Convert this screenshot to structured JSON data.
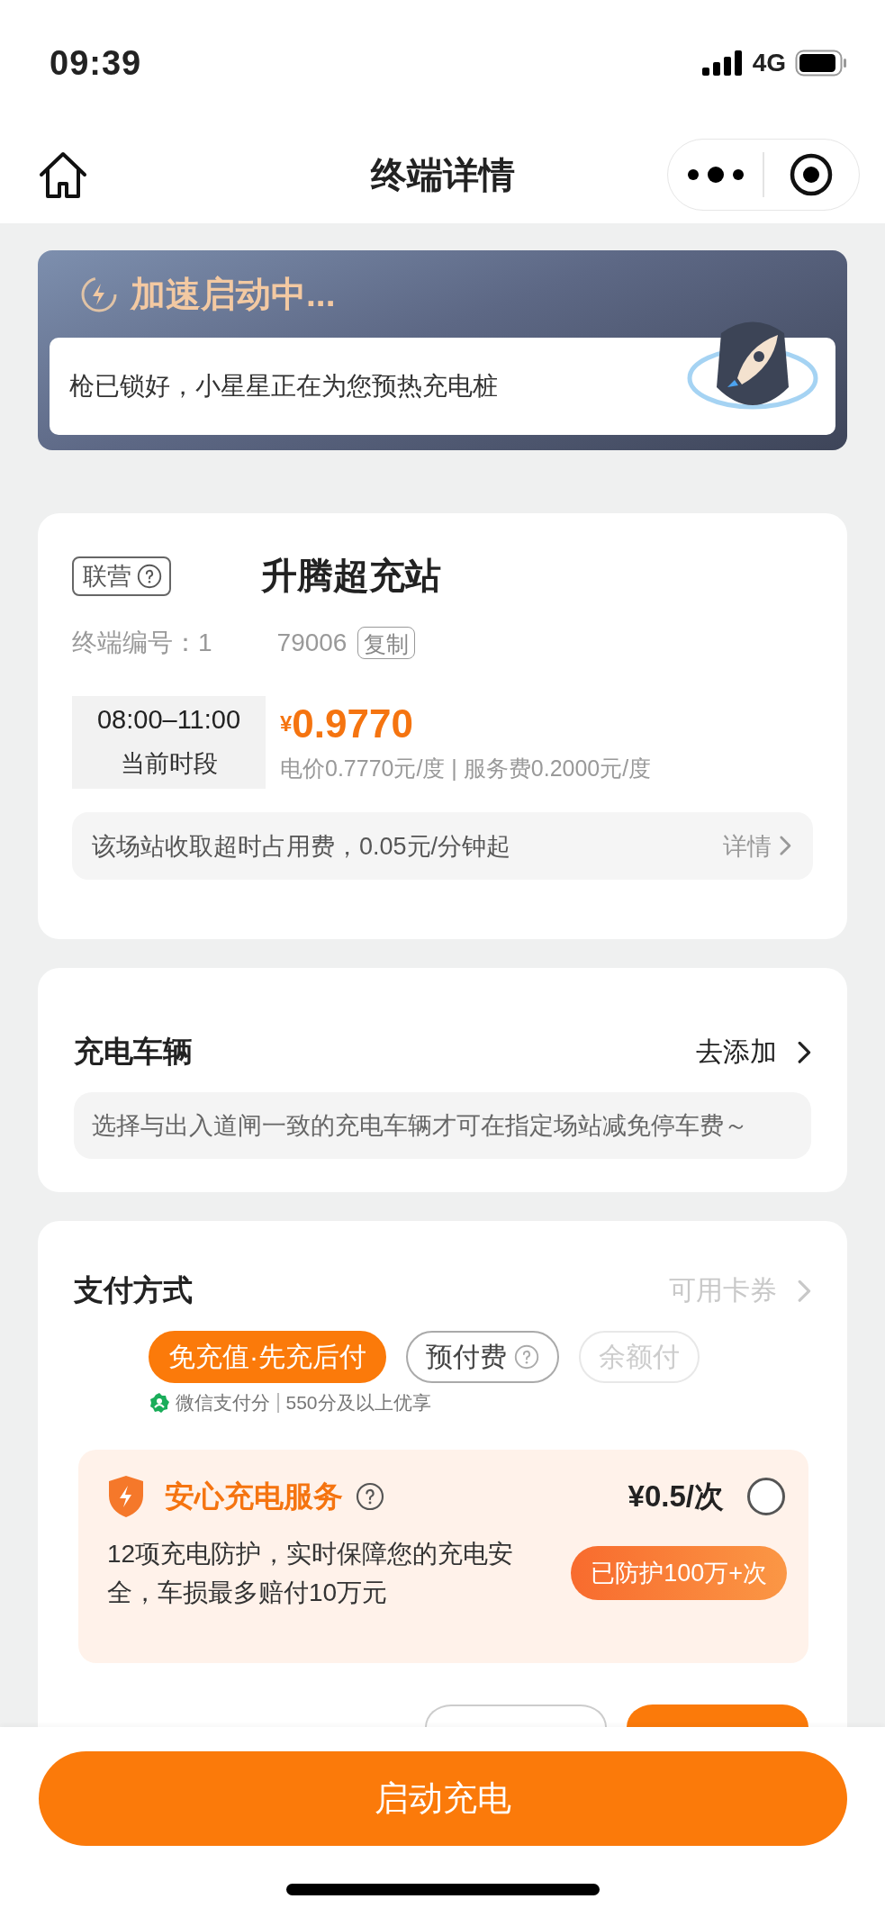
{
  "status_bar": {
    "time": "09:39",
    "network": "4G"
  },
  "nav": {
    "title": "终端详情"
  },
  "banner": {
    "title": "加速启动中...",
    "message": "枪已锁好，小星星正在为您预热充电桩"
  },
  "station": {
    "tag": "联营",
    "name": "升腾超充站",
    "terminal_label": "终端编号：1",
    "terminal_number": "79006",
    "copy_button": "复制",
    "period": {
      "time": "08:00–11:00",
      "label": "当前时段"
    },
    "currency": "¥",
    "price": "0.9770",
    "price_detail": "电价0.7770元/度 | 服务费0.2000元/度",
    "notice": "该场站收取超时占用费，0.05元/分钟起",
    "notice_link": "详情"
  },
  "vehicle": {
    "title": "充电车辆",
    "action": "去添加",
    "hint": "选择与出入道闸一致的充电车辆才可在指定场站减免停车费～"
  },
  "payment": {
    "title": "支付方式",
    "coupons": {
      "label": "可用卡券",
      "disabled": true
    },
    "options": [
      {
        "kind": "plain",
        "label": "免充值·先充后付",
        "selected": true,
        "disabled": false
      },
      {
        "kind": "help",
        "label": "预付费",
        "selected": false,
        "disabled": false
      },
      {
        "kind": "plain",
        "label": "余额付",
        "selected": false,
        "disabled": true
      }
    ],
    "credit": {
      "name": "微信支付分",
      "note": "550分及以上优享"
    },
    "service": {
      "title": "安心充电服务",
      "price": "¥0.5/次",
      "checked": false,
      "description": "12项充电防护，实时保障您的充电安全，车损最多赔付10万元",
      "badge": "已防护100万+次"
    },
    "settlement": {
      "options": [
        {
          "selected": false
        },
        {
          "selected": true
        }
      ]
    }
  },
  "start_button": "启动充电"
}
